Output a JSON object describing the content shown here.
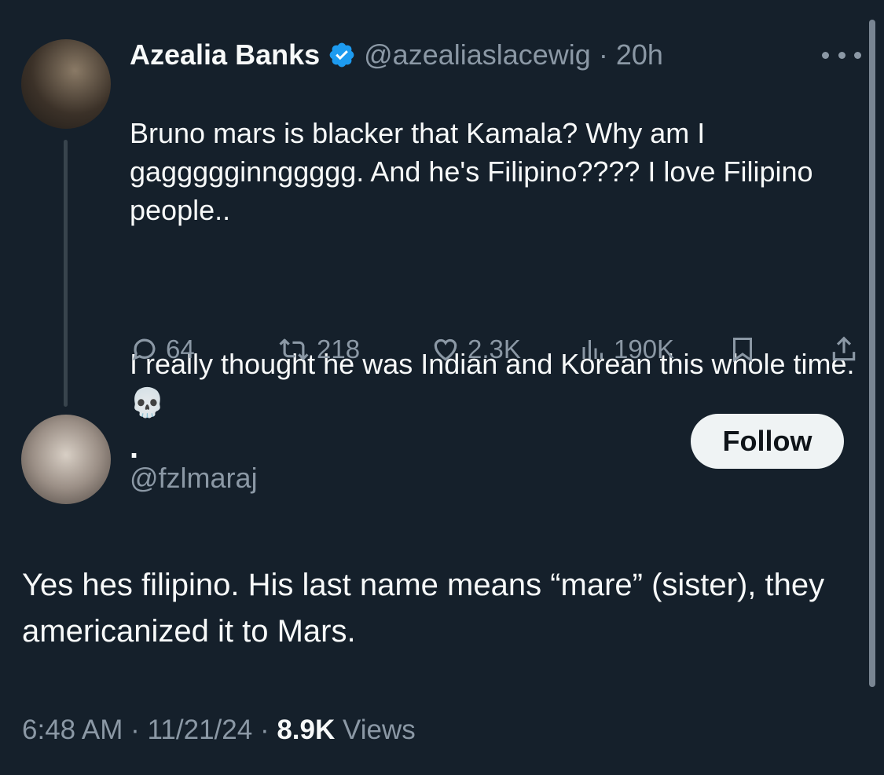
{
  "parent_tweet": {
    "display_name": "Azealia Banks",
    "handle": "@azealiaslacewig",
    "separator": "·",
    "time_ago": "20h",
    "text_paragraph_1": "Bruno mars is blacker that Kamala? Why am I gaggggginnggggg. And he's Filipino???? I love Filipino people..",
    "text_paragraph_2": "I really thought he was Indian and Korean this whole time. 💀",
    "stats": {
      "replies": "64",
      "reposts": "218",
      "likes": "2.3K",
      "views": "190K"
    }
  },
  "reply": {
    "display_name": ".",
    "handle": "@fzlmaraj",
    "follow_label": "Follow",
    "text": "Yes hes filipino. His last name means “mare” (sister), they americanized it to Mars.",
    "timestamp_time": "6:48 AM",
    "timestamp_date": "11/21/24",
    "views_count": "8.9K",
    "views_label": "Views",
    "separator": "·"
  },
  "colors": {
    "background": "#15202b",
    "primary_text": "#f7f9f9",
    "secondary_text": "#8b98a5",
    "verified_blue": "#1d9bf0",
    "follow_button_bg": "#eff3f4"
  },
  "icons": {
    "verified": "verified-badge-icon",
    "more": "more-horizontal-icon",
    "reply": "reply-bubble-icon",
    "repost": "repost-arrows-icon",
    "like": "heart-icon",
    "views": "bar-chart-icon",
    "bookmark": "bookmark-icon",
    "share": "share-upload-icon"
  }
}
